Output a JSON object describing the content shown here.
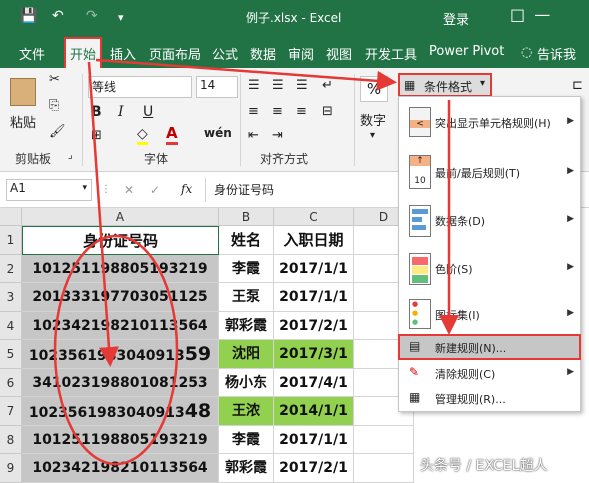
{
  "window": {
    "title": "例子.xlsx - Excel",
    "login": "登录",
    "controls": "□ —"
  },
  "quick_access": {
    "save": "💾",
    "undo": "↶",
    "redo": "↷",
    "customize": "▾"
  },
  "tabs": {
    "file": "文件",
    "home": "开始",
    "insert": "插入",
    "page_layout": "页面布局",
    "formulas": "公式",
    "data": "数据",
    "review": "审阅",
    "view": "视图",
    "developer": "开发工具",
    "power_pivot": "Power Pivot",
    "tell_me": "告诉我"
  },
  "ribbon": {
    "paste": "粘贴",
    "clipboard": "剪贴板",
    "font_name": "等线",
    "font_size": "14",
    "bold": "B",
    "italic": "I",
    "underline": "U",
    "font_color": "A",
    "wen": "wén",
    "font_group": "字体",
    "align_group": "对齐方式",
    "number": "数字",
    "percent": "%",
    "cond_format": "条件格式",
    "cond_format_arrow": "▾"
  },
  "formula_bar": {
    "name_box": "A1",
    "cancel": "✕",
    "confirm": "✓",
    "fx": "fx",
    "content": "身份证号码"
  },
  "columns": [
    "A",
    "B",
    "C",
    "D"
  ],
  "rows": [
    "1",
    "2",
    "3",
    "4",
    "5",
    "6",
    "7",
    "8",
    "9"
  ],
  "table": {
    "header": [
      "身份证号码",
      "姓名",
      "入职日期"
    ],
    "rows": [
      [
        "101251198805193219",
        "李霞",
        "2017/1/1"
      ],
      [
        "201333197703051125",
        "王泵",
        "2017/1/1"
      ],
      [
        "102342198210113564",
        "郭彩霞",
        "2017/2/1"
      ],
      [
        "102356198304091359",
        "沈阳",
        "2017/3/1"
      ],
      [
        "341023198801081253",
        "杨小东",
        "2017/4/1"
      ],
      [
        "102356198304091348",
        "王浓",
        "2014/1/1"
      ],
      [
        "101251198805193219",
        "李霞",
        "2017/1/1"
      ],
      [
        "102342198210113564",
        "郭彩霞",
        "2017/2/1"
      ]
    ]
  },
  "menu": {
    "items": [
      {
        "label": "突出显示单元格规则(H)",
        "arrow": "▶"
      },
      {
        "label": "最前/最后规则(T)",
        "arrow": "▶"
      },
      {
        "label": "数据条(D)",
        "arrow": "▶"
      },
      {
        "label": "色阶(S)",
        "arrow": "▶"
      },
      {
        "label": "图标集(I)",
        "arrow": "▶"
      },
      {
        "label": "新建规则(N)...",
        "arrow": ""
      },
      {
        "label": "清除规则(C)",
        "arrow": "▶"
      },
      {
        "label": "管理规则(R)...",
        "arrow": ""
      }
    ]
  },
  "watermark": "头条号 / EXCEL超人",
  "colors": {
    "excel_green": "#217346",
    "highlight_green": "#92d050",
    "annotation_red": "#e53935",
    "selection_gray": "#c6c6c6"
  }
}
